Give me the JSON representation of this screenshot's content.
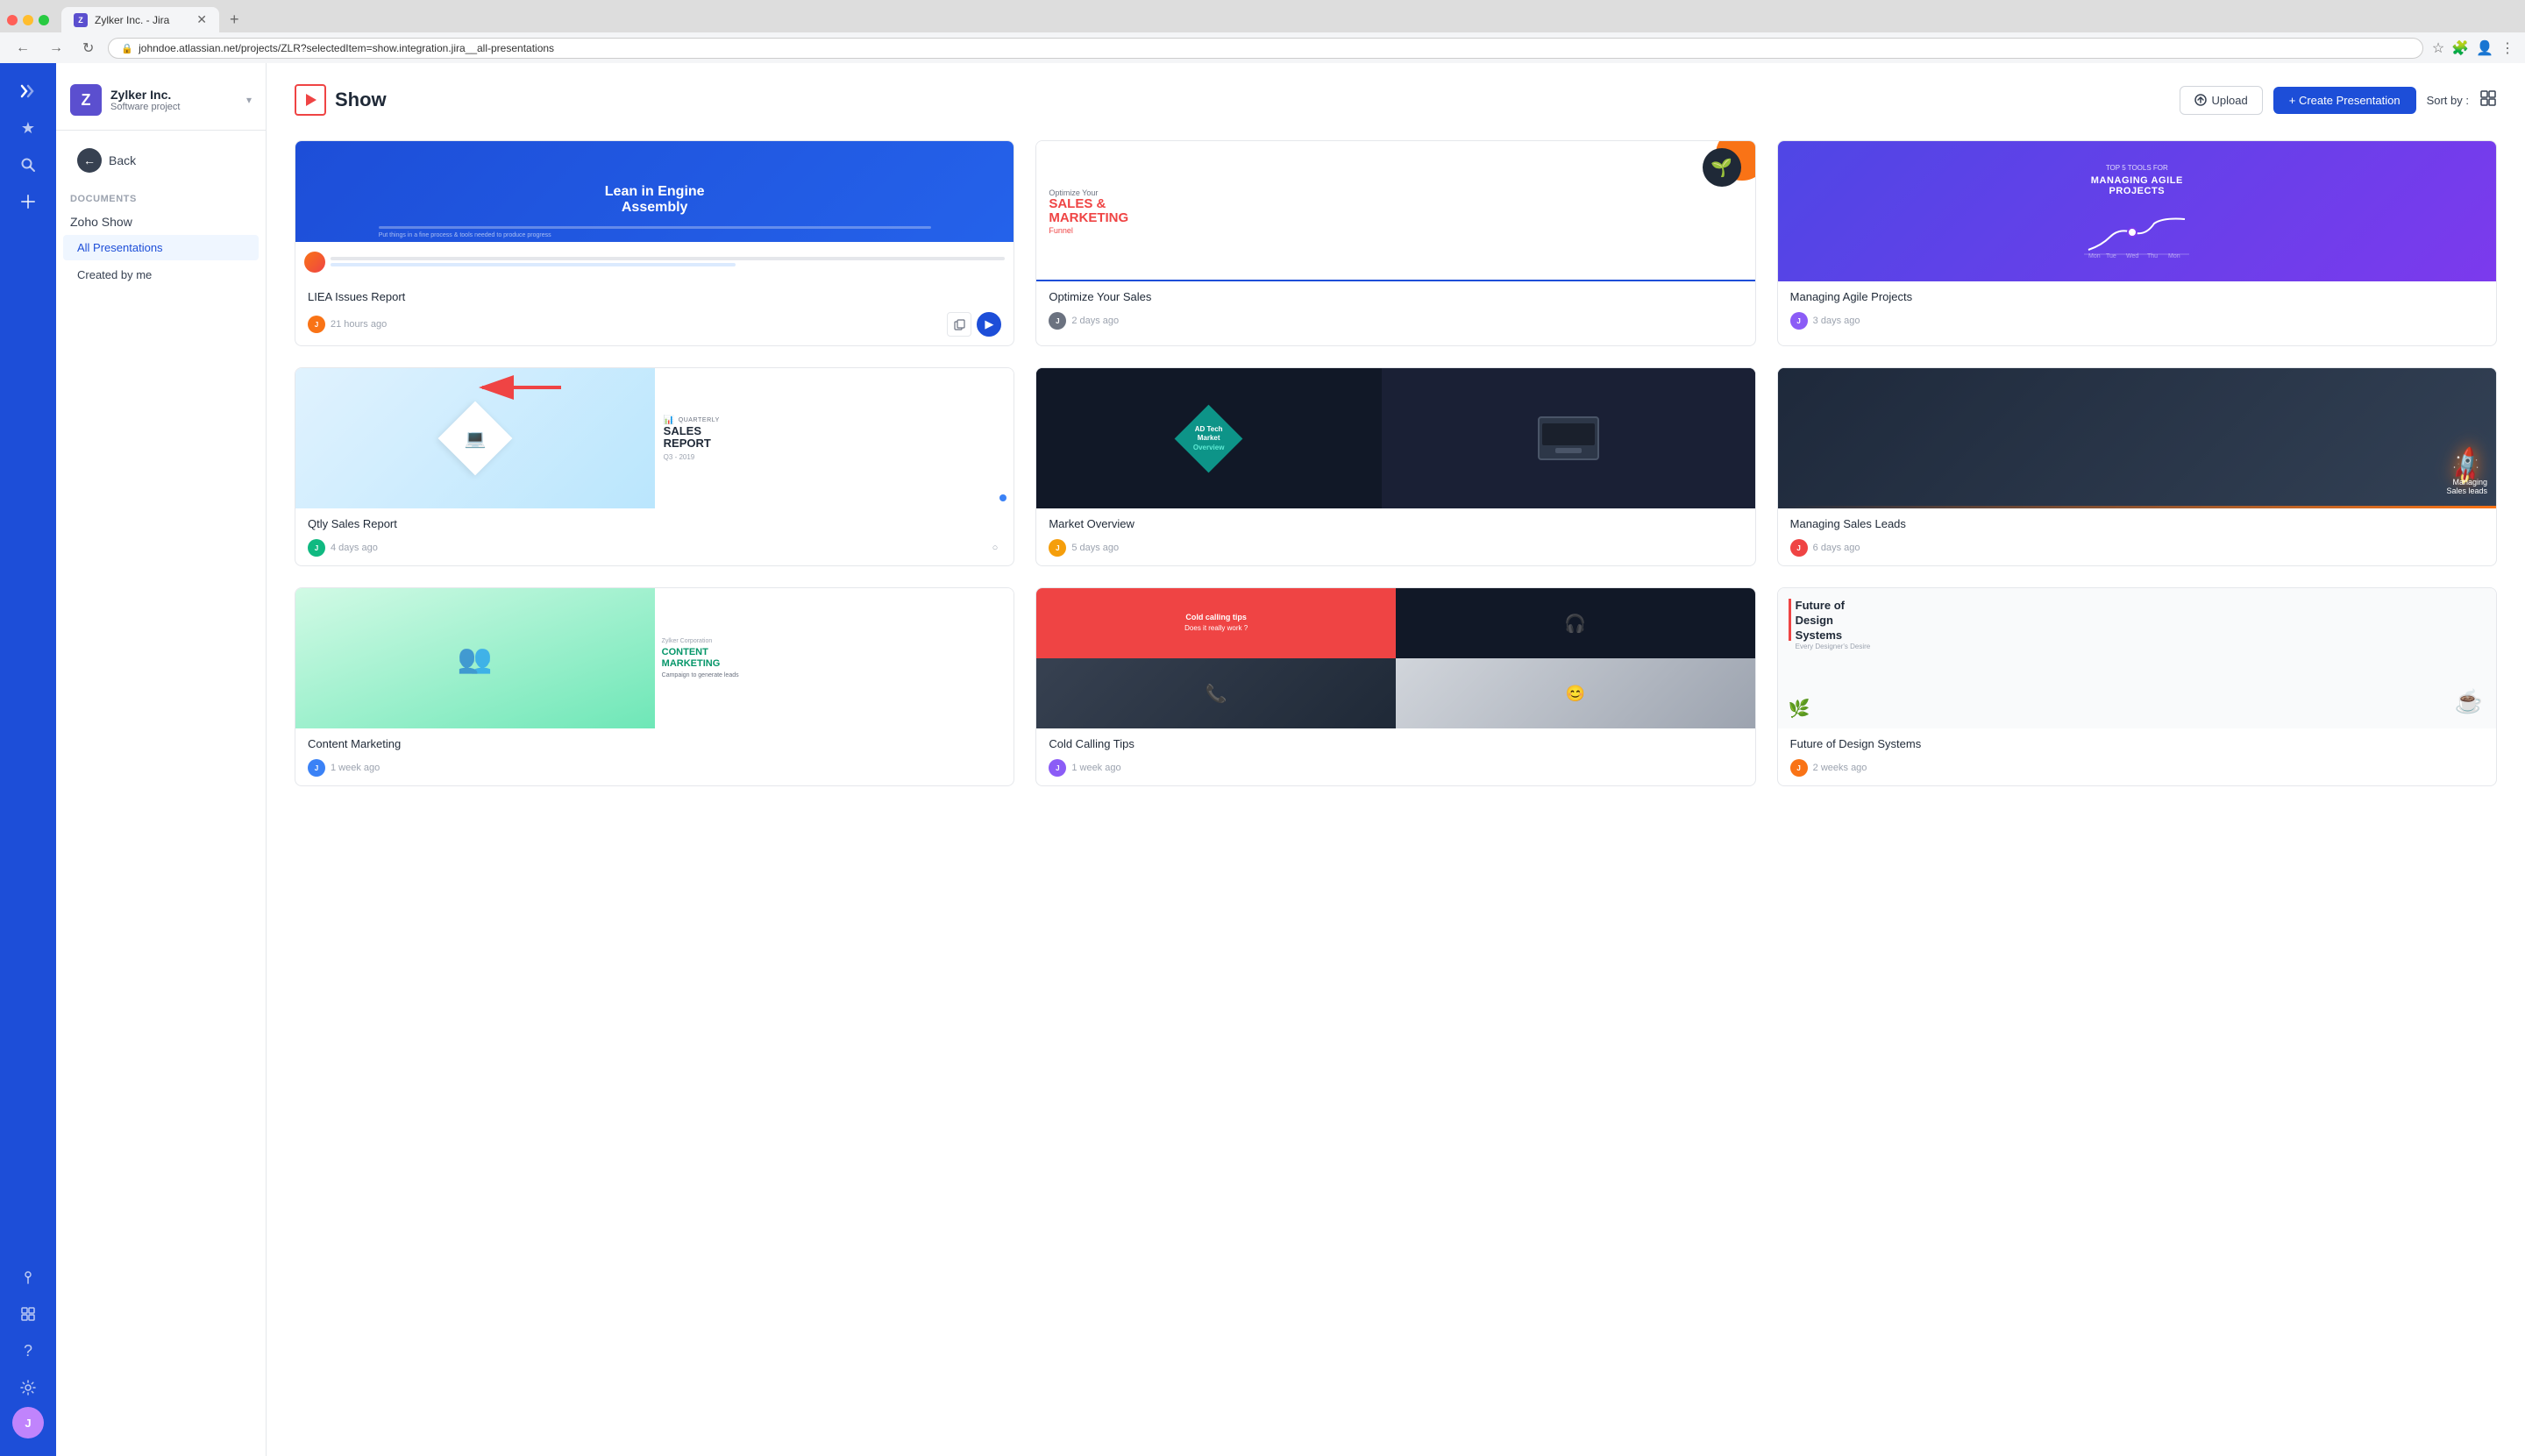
{
  "browser": {
    "tab_title": "Zylker Inc. - Jira",
    "url": "johndoe.atlassian.net/projects/ZLR?selectedItem=show.integration.jira__all-presentations",
    "tab_icon": "J"
  },
  "sidebar": {
    "project_logo": "Z",
    "project_name": "Zylker Inc.",
    "project_type": "Software project",
    "back_label": "Back",
    "app_section_label": "DOCUMENTS",
    "app_title": "Zoho Show",
    "nav_items": [
      {
        "label": "All Presentations",
        "active": true
      },
      {
        "label": "Created by me",
        "active": false
      }
    ]
  },
  "main": {
    "page_title": "Show",
    "upload_label": "Upload",
    "create_label": "+ Create Presentation",
    "sort_label": "Sort by :",
    "presentations": [
      {
        "id": "liea",
        "title": "LIEA Issues Report",
        "time_ago": "21 hours ago",
        "thumb_type": "liea"
      },
      {
        "id": "sales",
        "title": "Optimize Your Sales",
        "time_ago": "2 days ago",
        "thumb_type": "sales"
      },
      {
        "id": "agile",
        "title": "Managing Agile Projects",
        "time_ago": "3 days ago",
        "thumb_type": "agile"
      },
      {
        "id": "qtly",
        "title": "Qtly Sales Report",
        "time_ago": "4 days ago",
        "thumb_type": "qtly"
      },
      {
        "id": "market",
        "title": "Market Overview",
        "time_ago": "5 days ago",
        "thumb_type": "market"
      },
      {
        "id": "leads",
        "title": "Managing Sales Leads",
        "time_ago": "6 days ago",
        "thumb_type": "leads"
      },
      {
        "id": "content",
        "title": "Content Marketing",
        "time_ago": "1 week ago",
        "thumb_type": "content"
      },
      {
        "id": "cold",
        "title": "Cold Calling Tips",
        "time_ago": "1 week ago",
        "thumb_type": "cold"
      },
      {
        "id": "future",
        "title": "Future of Design Systems",
        "time_ago": "2 weeks ago",
        "thumb_type": "future"
      }
    ]
  },
  "icons": {
    "back_arrow": "←",
    "chevron_down": "▾",
    "star": "★",
    "search": "🔍",
    "plus": "+",
    "pin": "📌",
    "grid": "⊞",
    "question": "?",
    "gear": "⚙",
    "lock": "🔒",
    "bookmark": "⊕",
    "copy": "⧉",
    "play": "▶",
    "upload_icon": "↑",
    "sort_grid": "⊞"
  }
}
